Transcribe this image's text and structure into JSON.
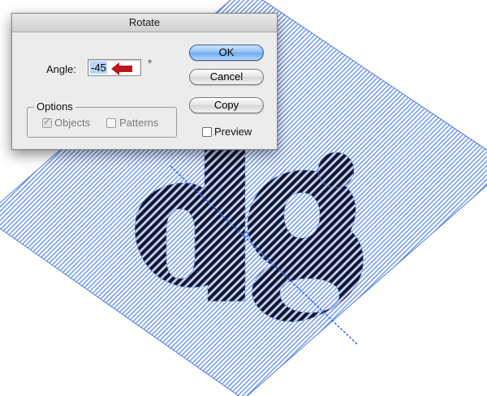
{
  "dialog": {
    "title": "Rotate",
    "angle_label": "Angle:",
    "angle_value": "-45",
    "angle_unit": "°",
    "options": {
      "legend": "Options",
      "objects_label": "Objects",
      "objects_checked": true,
      "patterns_label": "Patterns",
      "patterns_checked": false
    },
    "ok_label": "OK",
    "cancel_label": "Cancel",
    "copy_label": "Copy",
    "preview_label": "Preview",
    "preview_checked": false
  },
  "colors": {
    "accent": "#5b8def",
    "arrow": "#c0141c",
    "stripe": "#0f1732",
    "selection": "#b5d5ff"
  }
}
